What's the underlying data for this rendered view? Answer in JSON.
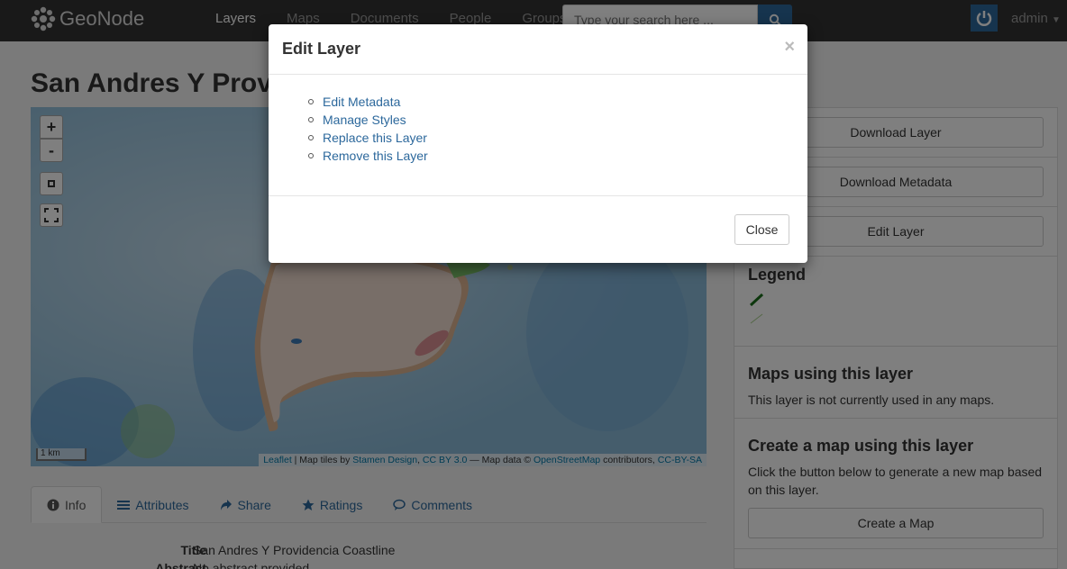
{
  "navbar": {
    "brand": "GeoNode",
    "links": [
      "Layers",
      "Maps",
      "Documents",
      "People",
      "Groups"
    ],
    "active_link": "Layers",
    "search_placeholder": "Type your search here ...",
    "user": "admin"
  },
  "page": {
    "title": "San Andres Y Providencia Coastline"
  },
  "map": {
    "zoom_in": "+",
    "zoom_out": "-",
    "scale": "1 km",
    "attribution": {
      "leaflet": "Leaflet",
      "sep1": " | Map tiles by ",
      "stamen": "Stamen Design",
      "sep2": ", ",
      "cc": "CC BY 3.0",
      "sep3": " — Map data © ",
      "osm": "OpenStreetMap",
      "sep4": " contributors, ",
      "ccsa": "CC-BY-SA"
    }
  },
  "tabs": [
    {
      "label": "Info",
      "icon": "info-icon"
    },
    {
      "label": "Attributes",
      "icon": "list-icon"
    },
    {
      "label": "Share",
      "icon": "share-icon"
    },
    {
      "label": "Ratings",
      "icon": "star-icon"
    },
    {
      "label": "Comments",
      "icon": "comment-icon"
    }
  ],
  "info": {
    "title_label": "Title",
    "title_value": "San Andres Y Providencia Coastline",
    "abstract_label": "Abstract",
    "abstract_value": "No abstract provided"
  },
  "sidebar": {
    "download_layer": "Download Layer",
    "download_metadata": "Download Metadata",
    "edit_layer": "Edit Layer",
    "legend_heading": "Legend",
    "maps_heading": "Maps using this layer",
    "maps_text": "This layer is not currently used in any maps.",
    "create_heading": "Create a map using this layer",
    "create_text": "Click the button below to generate a new map based on this layer.",
    "create_button": "Create a Map"
  },
  "modal": {
    "title": "Edit Layer",
    "close_x": "×",
    "items": [
      "Edit Metadata",
      "Manage Styles",
      "Replace this Layer",
      "Remove this Layer"
    ],
    "close_button": "Close"
  },
  "colors": {
    "navbar": "#333333",
    "link": "#2c689c",
    "water": "#9fc6e0"
  }
}
